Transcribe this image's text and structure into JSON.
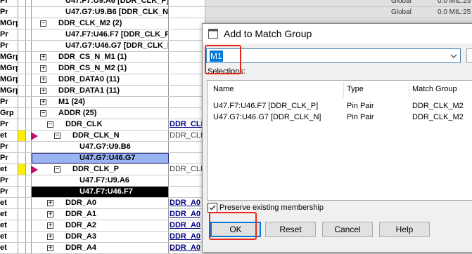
{
  "grid_rows": [
    {
      "type": "Pr",
      "name": "U47.F7:U9.A6 [DDR_CLK_P]",
      "indent": 1,
      "toggle": "",
      "cls": "",
      "scope": "Global",
      "val": "0.0 MIL:25"
    },
    {
      "type": "Pr",
      "name": "U47.G7:U9.B6 [DDR_CLK_N]",
      "indent": 1,
      "toggle": "",
      "cls": "",
      "scope": "Global",
      "val": "0.0 MIL:25"
    },
    {
      "type": "MGrp",
      "name": "DDR_CLK_M2 (2)",
      "indent": 0,
      "toggle": "−",
      "cls": "",
      "scope": "",
      "val": ""
    },
    {
      "type": "Pr",
      "name": "U47.F7:U46.F7 [DDR_CLK_P]",
      "indent": 1,
      "toggle": "",
      "cls": "",
      "scope": "",
      "val": ""
    },
    {
      "type": "Pr",
      "name": "U47.G7:U46.G7 [DDR_CLK_N",
      "indent": 1,
      "toggle": "",
      "cls": "",
      "scope": "",
      "val": ""
    },
    {
      "type": "MGrp",
      "name": "DDR_CS_N_M1 (1)",
      "indent": 0,
      "toggle": "+",
      "cls": "",
      "scope": "",
      "val": ""
    },
    {
      "type": "MGrp",
      "name": "DDR_CS_N_M2 (1)",
      "indent": 0,
      "toggle": "+",
      "cls": "",
      "scope": "",
      "val": ""
    },
    {
      "type": "MGrp",
      "name": "DDR_DATA0 (11)",
      "indent": 0,
      "toggle": "+",
      "cls": "",
      "scope": "",
      "val": ""
    },
    {
      "type": "MGrp",
      "name": "DDR_DATA1 (11)",
      "indent": 0,
      "toggle": "+",
      "cls": "",
      "scope": "",
      "val": ""
    },
    {
      "type": "Pr",
      "name": "M1 (24)",
      "indent": 0,
      "toggle": "+",
      "cls": "",
      "scope": "",
      "val": ""
    },
    {
      "type": "Grp",
      "name": "ADDR (25)",
      "indent": 0,
      "toggle": "−",
      "cls": "",
      "scope": "",
      "val": ""
    },
    {
      "type": "Pr",
      "name": "DDR_CLK",
      "indent": 1,
      "toggle": "−",
      "cls": "DDR_CLK",
      "scope": "",
      "val": ""
    },
    {
      "type": "et",
      "name": "DDR_CLK_N",
      "indent": 2,
      "toggle": "−",
      "cls": "DDR_CLK",
      "clsPlain": true,
      "marker": true,
      "yellow": true,
      "scope": "",
      "val": ""
    },
    {
      "type": "Pr",
      "name": "U47.G7:U9.B6",
      "indent": 3,
      "toggle": "",
      "cls": "",
      "scope": "",
      "val": ""
    },
    {
      "type": "Pr",
      "name": "U47.G7:U46.G7",
      "indent": 3,
      "toggle": "",
      "cls": "",
      "sel": "blue",
      "scope": "",
      "val": ""
    },
    {
      "type": "et",
      "name": "DDR_CLK_P",
      "indent": 2,
      "toggle": "−",
      "cls": "DDR_CLK",
      "clsPlain": true,
      "marker": true,
      "yellow": true,
      "scope": "",
      "val": ""
    },
    {
      "type": "Pr",
      "name": "U47.F7:U9.A6",
      "indent": 3,
      "toggle": "",
      "cls": "",
      "scope": "",
      "val": ""
    },
    {
      "type": "Pr",
      "name": "U47.F7:U46.F7",
      "indent": 3,
      "toggle": "",
      "cls": "",
      "sel": "black",
      "scope": "",
      "val": ""
    },
    {
      "type": "et",
      "name": "DDR_A0",
      "indent": 1,
      "toggle": "+",
      "cls": "DDR_A0",
      "scope": "",
      "val": ""
    },
    {
      "type": "et",
      "name": "DDR_A1",
      "indent": 1,
      "toggle": "+",
      "cls": "DDR_A0",
      "scope": "",
      "val": ""
    },
    {
      "type": "et",
      "name": "DDR_A2",
      "indent": 1,
      "toggle": "+",
      "cls": "DDR_A0",
      "scope": "",
      "val": ""
    },
    {
      "type": "et",
      "name": "DDR_A3",
      "indent": 1,
      "toggle": "+",
      "cls": "DDR_A0",
      "scope": "",
      "val": ""
    },
    {
      "type": "et",
      "name": "DDR_A4",
      "indent": 1,
      "toggle": "+",
      "cls": "DDR_A0",
      "scope": "",
      "val": ""
    }
  ],
  "dialog": {
    "title": "Add to Match Group",
    "combo_value": "M1",
    "selections_label": "Selections:",
    "columns": [
      "Name",
      "Type",
      "Match Group"
    ],
    "rows": [
      {
        "name": "U47.F7:U46.F7 [DDR_CLK_P]",
        "type": "Pin Pair",
        "group": "DDR_CLK_M2"
      },
      {
        "name": "U47.G7:U46.G7 [DDR_CLK_N]",
        "type": "Pin Pair",
        "group": "DDR_CLK_M2"
      }
    ],
    "preserve_label": "Preserve existing membership",
    "preserve_checked": true,
    "ok_label": "OK",
    "reset_label": "Reset",
    "cancel_label": "Cancel",
    "help_label": "Help"
  },
  "colors": {
    "highlight": "#e8281e",
    "selection_blue": "#99b4f0",
    "accent": "#0078d7"
  }
}
